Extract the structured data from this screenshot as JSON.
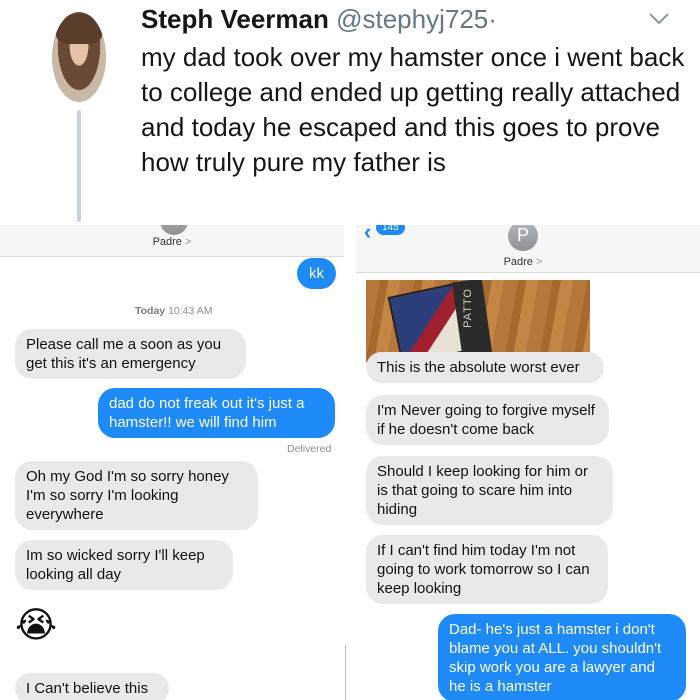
{
  "tweet": {
    "display_name": "Steph Veerman",
    "handle": "@stephyj725",
    "separator": "·",
    "text": "my dad took over my hamster once i went back to college and ended up getting really attached and today he escaped and this goes to prove how truly pure my father is",
    "menu_icon": "chevron-down-icon"
  },
  "left_screenshot": {
    "contact_name": "Padre",
    "contact_chevron": ">",
    "timestamp_day": "Today",
    "timestamp_time": "10:43 AM",
    "delivered_label": "Delivered",
    "messages": [
      {
        "from": "me",
        "text": "kk"
      },
      {
        "from": "dad",
        "text": "Please call me a soon as you get this it's an emergency"
      },
      {
        "from": "me",
        "text": "dad do not freak out it's just a hamster!! we will find him"
      },
      {
        "from": "dad",
        "text": "Oh my God I'm so sorry honey I'm so sorry I'm looking everywhere"
      },
      {
        "from": "dad",
        "text": "Im so wicked sorry I'll keep looking all day"
      },
      {
        "from": "dad",
        "text": "😭"
      },
      {
        "from": "dad",
        "text": "I Can't believe this"
      }
    ]
  },
  "right_screenshot": {
    "back_badge": "145",
    "contact_initial": "P",
    "contact_name": "Padre",
    "contact_chevron": ">",
    "photo_spine_text": "PATTO",
    "messages": [
      {
        "from": "dad",
        "text": "This is the absolute worst ever"
      },
      {
        "from": "dad",
        "text": "I'm Never going to forgive myself if he doesn't come back"
      },
      {
        "from": "dad",
        "text": "Should I keep looking for him or is that going to scare him into hiding"
      },
      {
        "from": "dad",
        "text": "If I can't find him today I'm not going to work tomorrow so I can keep looking"
      },
      {
        "from": "me",
        "text": "Dad- he's just a hamster i don't blame you at ALL. you shouldn't skip work you are a lawyer and he is a hamster"
      }
    ]
  },
  "colors": {
    "imessage_blue": "#1e8af7",
    "incoming_gray": "#e9e9eb",
    "twitter_gray": "#657786"
  }
}
